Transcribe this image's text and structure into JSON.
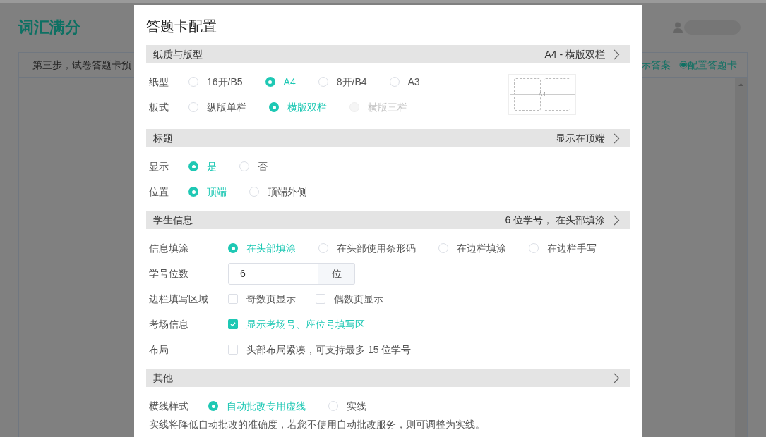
{
  "background": {
    "logo": "词汇满分",
    "panel_heading": "第三步，试卷答题卡预",
    "panel_links": [
      "示答案",
      "配置答题卡"
    ]
  },
  "dialog": {
    "title": "答题卡配置",
    "sections": [
      {
        "title": "纸质与版型",
        "summary": "A4 - 横版双栏",
        "preview": {
          "label": "A4"
        },
        "rows": [
          {
            "kind": "radio",
            "label": "纸型",
            "options": [
              {
                "label": "16开/B5",
                "selected": false
              },
              {
                "label": "A4",
                "selected": true
              },
              {
                "label": "8开/B4",
                "selected": false
              },
              {
                "label": "A3",
                "selected": false
              }
            ]
          },
          {
            "kind": "radio",
            "label": "板式",
            "options": [
              {
                "label": "纵版单栏",
                "selected": false,
                "disabled": false
              },
              {
                "label": "横版双栏",
                "selected": true,
                "disabled": false
              },
              {
                "label": "横版三栏",
                "selected": false,
                "disabled": true
              }
            ]
          }
        ]
      },
      {
        "title": "标题",
        "summary": "显示在顶端",
        "rows": [
          {
            "kind": "radio",
            "label": "显示",
            "options": [
              {
                "label": "是",
                "selected": true
              },
              {
                "label": "否",
                "selected": false
              }
            ]
          },
          {
            "kind": "radio",
            "label": "位置",
            "options": [
              {
                "label": "顶端",
                "selected": true
              },
              {
                "label": "顶端外侧",
                "selected": false
              }
            ]
          }
        ]
      },
      {
        "title": "学生信息",
        "summary": "6 位学号， 在头部填涂",
        "rows": [
          {
            "kind": "radio",
            "label": "信息填涂",
            "options": [
              {
                "label": "在头部填涂",
                "selected": true
              },
              {
                "label": "在头部使用条形码",
                "selected": false
              },
              {
                "label": "在边栏填涂",
                "selected": false
              },
              {
                "label": "在边栏手写",
                "selected": false
              }
            ]
          },
          {
            "kind": "input",
            "label": "学号位数",
            "value": "6",
            "unit": "位"
          },
          {
            "kind": "checkbox",
            "label": "边栏填写区域",
            "options": [
              {
                "label": "奇数页显示",
                "checked": false
              },
              {
                "label": "偶数页显示",
                "checked": false
              }
            ]
          },
          {
            "kind": "checkbox",
            "label": "考场信息",
            "options": [
              {
                "label": "显示考场号、座位号填写区",
                "checked": true
              }
            ]
          },
          {
            "kind": "checkbox",
            "label": "布局",
            "options": [
              {
                "label": "头部布局紧凑，可支持最多 15 位学号",
                "checked": false
              }
            ]
          }
        ]
      },
      {
        "title": "其他",
        "rows": [
          {
            "kind": "radio",
            "label": "横线样式",
            "options": [
              {
                "label": "自动批改专用虚线",
                "selected": true
              },
              {
                "label": "实线",
                "selected": false
              }
            ]
          },
          {
            "kind": "note",
            "text": "实线将降低自动批改的准确度，若您不使用自动批改服务，则可调整为实线。"
          }
        ]
      }
    ]
  }
}
